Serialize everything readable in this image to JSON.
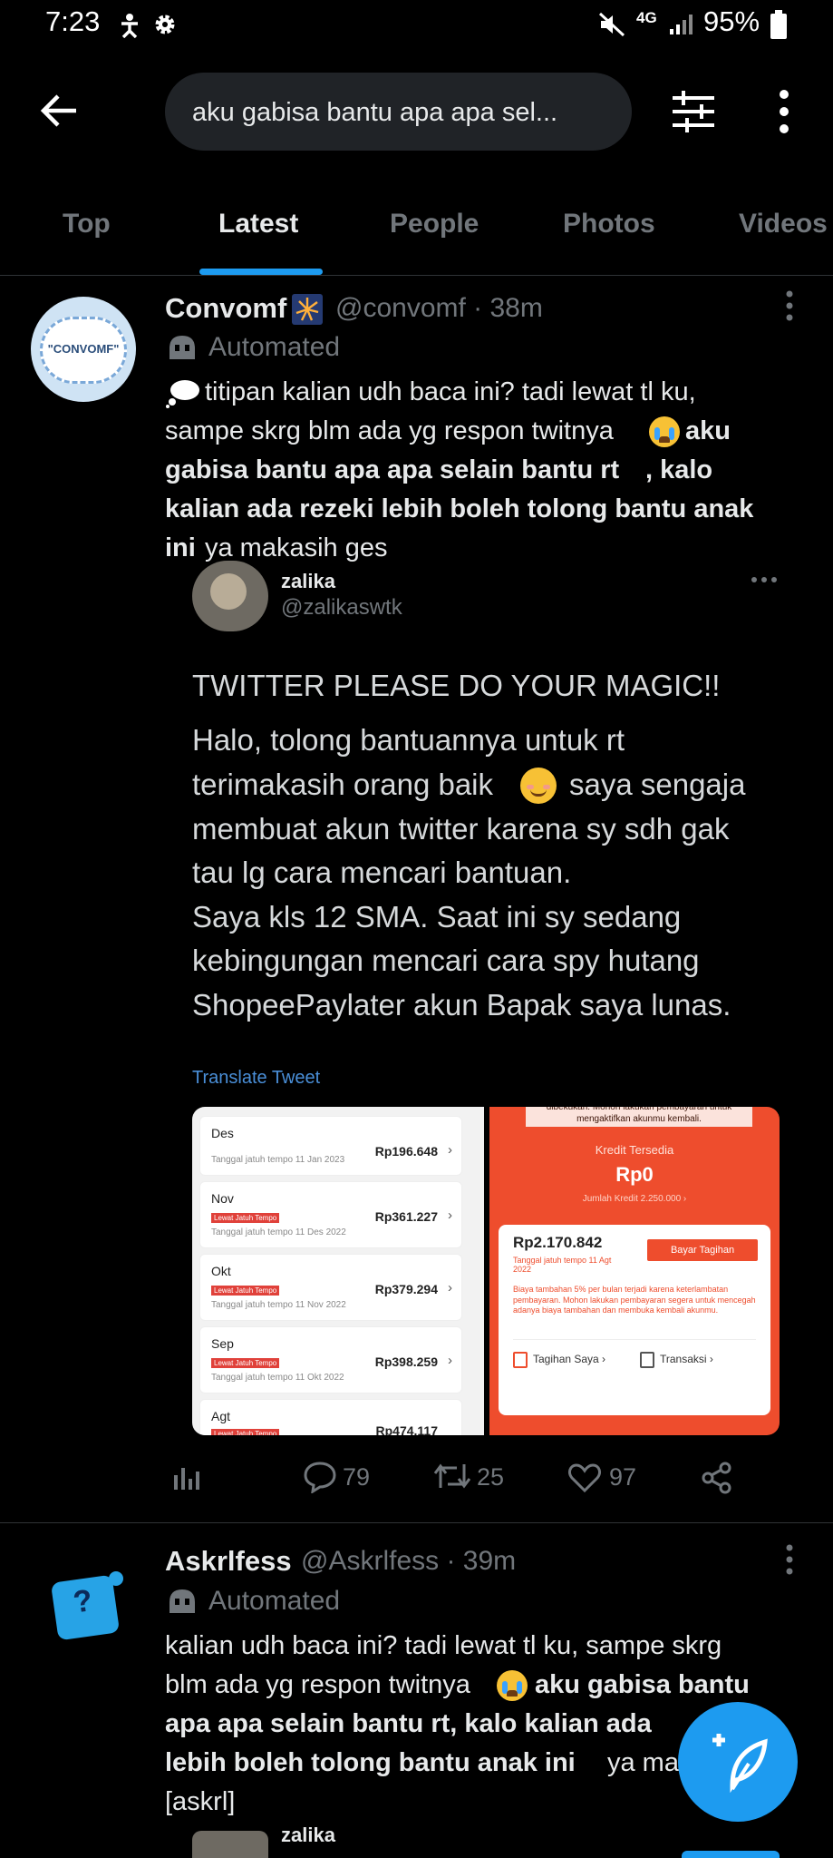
{
  "status_bar": {
    "time": "7:23",
    "network": "4G",
    "battery": "95%"
  },
  "search": {
    "query": "aku gabisa bantu apa apa sel..."
  },
  "tabs": [
    "Top",
    "Latest",
    "People",
    "Photos",
    "Videos"
  ],
  "active_tab": "Latest",
  "tweets": [
    {
      "name": "Convomf",
      "handle_time": "@convomf · 38m",
      "label": "Automated",
      "avatar_text": "\"CONVOMF\"",
      "text_lines": [
        "titipan kalian udh baca ini? tadi lewat tl ku,",
        "sampe skrg blm ada yg respon twitnya",
        "aku",
        "gabisa bantu apa apa selain bantu rt",
        ", kalo",
        "kalian ada rezeki lebih boleh tolong bantu anak",
        "ini",
        "ya makasih ges"
      ],
      "quote": {
        "name": "zalika",
        "handle": "@zalikaswtk",
        "heading": "TWITTER PLEASE DO YOUR MAGIC!!",
        "lines": [
          "Halo, tolong bantuannya untuk rt",
          "terimakasih orang baik",
          "saya sengaja",
          "membuat akun twitter karena sy sdh gak",
          "tau lg cara mencari bantuan.",
          "Saya kls 12 SMA. Saat ini sy sedang",
          "kebingungan mencari cara spy hutang",
          "ShopeePaylater akun Bapak saya lunas."
        ],
        "translate": "Translate Tweet"
      },
      "image_left": {
        "late_label": "Lewat Jatuh Tempo",
        "rows": [
          {
            "month": "Des",
            "due": "Tanggal jatuh tempo 11 Jan 2023",
            "amount": "Rp196.648"
          },
          {
            "month": "Nov",
            "due": "Tanggal jatuh tempo 11 Des 2022",
            "amount": "Rp361.227"
          },
          {
            "month": "Okt",
            "due": "Tanggal jatuh tempo 11 Nov 2022",
            "amount": "Rp379.294"
          },
          {
            "month": "Sep",
            "due": "Tanggal jatuh tempo 11 Okt 2022",
            "amount": "Rp398.259"
          },
          {
            "month": "Agt",
            "due": "",
            "amount": "Rp474.117"
          }
        ]
      },
      "image_right": {
        "notice": "dibekukan. Mohon lakukan pembayaran untuk mengaktifkan akunmu kembali.",
        "credit_label": "Kredit Tersedia",
        "credit_value": "Rp0",
        "limit": "Jumlah Kredit 2.250.000 ›",
        "bill_amount": "Rp2.170.842",
        "bill_due": "Tanggal jatuh tempo 11 Agt 2022",
        "pay_button": "Bayar Tagihan",
        "fee_note": "Biaya tambahan 5% per bulan terjadi karena keterlambatan pembayaran. Mohon lakukan pembayaran segera untuk mencegah adanya biaya tambahan dan membuka kembali akunmu.",
        "link1": "Tagihan Saya ›",
        "link2": "Transaksi ›"
      },
      "stats": {
        "replies": "79",
        "retweets": "25",
        "likes": "97"
      }
    },
    {
      "name": "Askrlfess",
      "handle_time": "@Askrlfess · 39m",
      "label": "Automated",
      "text_lines": [
        "kalian udh baca ini? tadi lewat tl ku, sampe skrg",
        "blm ada yg respon twitnya",
        "aku gabisa bantu",
        "apa apa selain bantu rt, kalo kalian ada",
        "lebih boleh tolong bantu anak ini",
        "ya ma",
        "[askrl]"
      ],
      "quote_name": "zalika"
    }
  ]
}
